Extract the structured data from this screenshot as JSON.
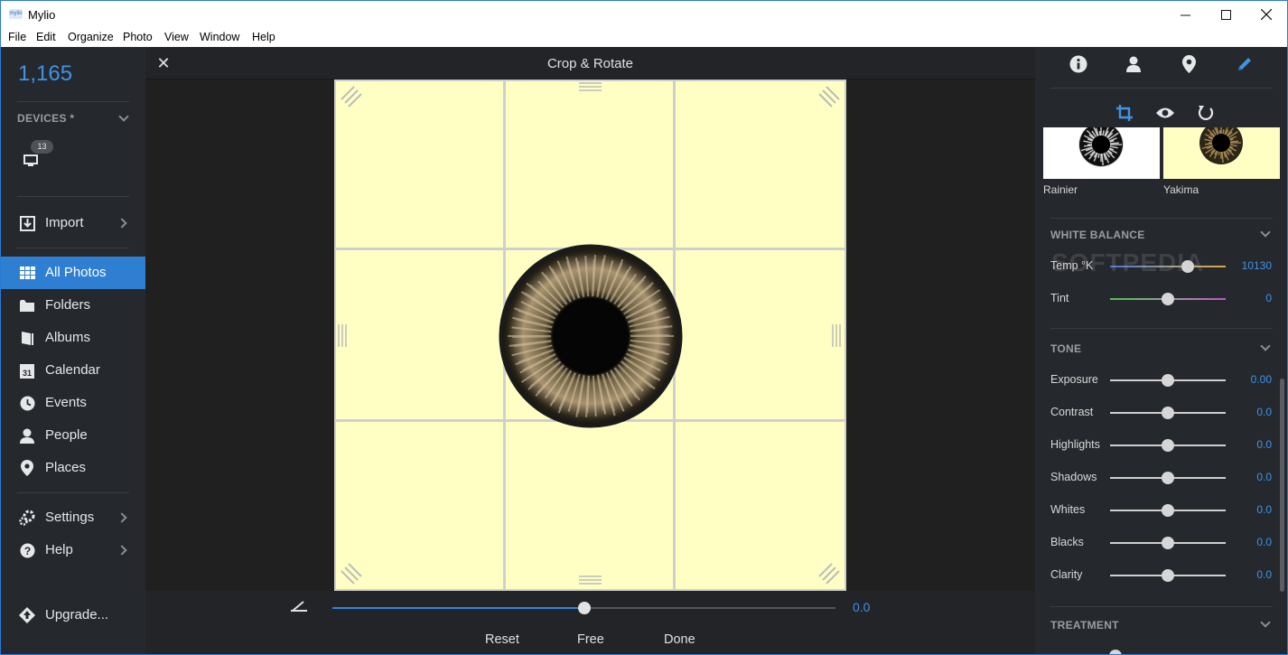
{
  "window": {
    "app_name": "Mylio",
    "logo_text": "mylio",
    "controls": {
      "minimize": "—",
      "maximize": "☐",
      "close": "✕"
    }
  },
  "menu": [
    "File",
    "Edit",
    "Organize",
    "Photo",
    "View",
    "Window",
    "Help"
  ],
  "sidebar": {
    "photo_count": "1,165",
    "devices_label": "DEVICES *",
    "device_badge": "13",
    "items": [
      {
        "label": "Import",
        "icon": "import-icon",
        "chevron": true,
        "active": false
      },
      {
        "label": "All Photos",
        "icon": "grid-icon",
        "chevron": false,
        "active": true
      },
      {
        "label": "Folders",
        "icon": "folder-icon",
        "chevron": false,
        "active": false
      },
      {
        "label": "Albums",
        "icon": "album-icon",
        "chevron": false,
        "active": false
      },
      {
        "label": "Calendar",
        "icon": "calendar-icon",
        "chevron": false,
        "active": false
      },
      {
        "label": "Events",
        "icon": "clock-icon",
        "chevron": false,
        "active": false
      },
      {
        "label": "People",
        "icon": "person-icon",
        "chevron": false,
        "active": false
      },
      {
        "label": "Places",
        "icon": "pin-icon",
        "chevron": false,
        "active": false
      },
      {
        "label": "Settings",
        "icon": "gear-icon",
        "chevron": true,
        "active": false
      },
      {
        "label": "Help",
        "icon": "help-icon",
        "chevron": true,
        "active": false
      },
      {
        "label": "Upgrade...",
        "icon": "upgrade-icon",
        "chevron": false,
        "active": false
      }
    ],
    "calendar_day": "31"
  },
  "crop": {
    "title": "Crop & Rotate",
    "close_symbol": "✕",
    "rotation_value": "0.0",
    "rotation_fraction": 0.5,
    "buttons": {
      "reset": "Reset",
      "free": "Free",
      "done": "Done"
    },
    "canvas_color": "#ffffc4"
  },
  "right_panel": {
    "top_icons": [
      "info-icon",
      "person-icon",
      "location-icon",
      "edit-pencil-icon"
    ],
    "tool_icons": [
      "crop-icon",
      "eye-icon",
      "rotate-icon"
    ],
    "presets": [
      {
        "name": "Rainier"
      },
      {
        "name": "Yakima"
      }
    ],
    "white_balance": {
      "title": "WHITE BALANCE",
      "rows": [
        {
          "label": "Temp °K",
          "value": "10130",
          "fraction": 0.67
        },
        {
          "label": "Tint",
          "value": "0",
          "fraction": 0.5
        }
      ]
    },
    "tone": {
      "title": "TONE",
      "rows": [
        {
          "label": "Exposure",
          "value": "0.00",
          "fraction": 0.5
        },
        {
          "label": "Contrast",
          "value": "0.0",
          "fraction": 0.5
        },
        {
          "label": "Highlights",
          "value": "0.0",
          "fraction": 0.5
        },
        {
          "label": "Shadows",
          "value": "0.0",
          "fraction": 0.5
        },
        {
          "label": "Whites",
          "value": "0.0",
          "fraction": 0.5
        },
        {
          "label": "Blacks",
          "value": "0.0",
          "fraction": 0.5
        },
        {
          "label": "Clarity",
          "value": "0.0",
          "fraction": 0.5
        }
      ]
    },
    "treatment": {
      "title": "TREATMENT"
    },
    "watermark": "SOFTPEDIA"
  },
  "colors": {
    "accent": "#2e7ed2",
    "value_blue": "#3f94e6",
    "sidebar_bg": "#25282d"
  }
}
